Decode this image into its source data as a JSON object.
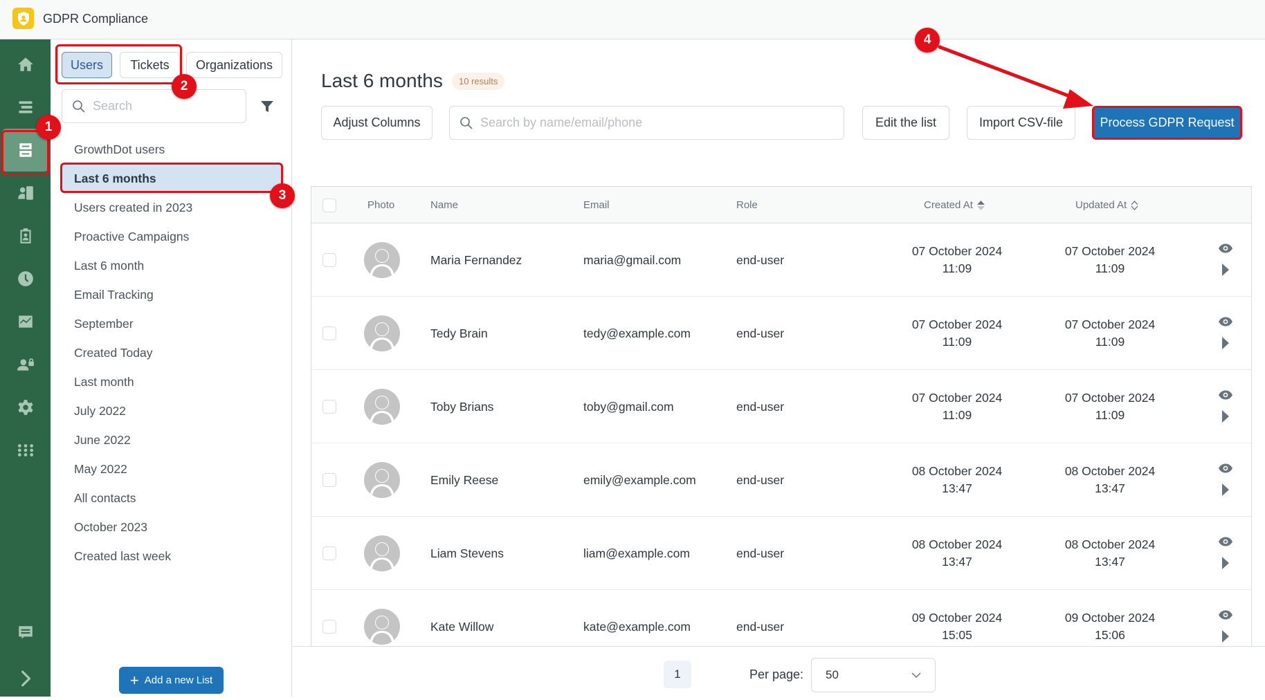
{
  "app": {
    "title": "GDPR Compliance",
    "logo_icon": "shield-user-icon",
    "logo_color": "#f5c518"
  },
  "rail": {
    "color": "#2d6647",
    "items": [
      {
        "icon": "home-icon",
        "active": false
      },
      {
        "icon": "views-icon",
        "active": false
      },
      {
        "icon": "lists-icon",
        "active": true
      },
      {
        "icon": "contacts-icon",
        "active": false
      },
      {
        "icon": "clipboard-user-icon",
        "active": false
      },
      {
        "icon": "clock-icon",
        "active": false
      },
      {
        "icon": "reports-chart-icon",
        "active": false
      },
      {
        "icon": "user-lock-icon",
        "active": false
      },
      {
        "icon": "gear-icon",
        "active": false
      },
      {
        "icon": "apps-grid-icon",
        "active": false
      }
    ],
    "bottom_items": [
      {
        "icon": "chat-icon"
      },
      {
        "icon": "chevron-right-icon"
      }
    ]
  },
  "list_panel": {
    "tabs": [
      {
        "label": "Users",
        "active": true
      },
      {
        "label": "Tickets",
        "active": false
      },
      {
        "label": "Organizations",
        "active": false
      }
    ],
    "search_placeholder": "Search",
    "items": [
      {
        "label": "GrowthDot users",
        "active": false
      },
      {
        "label": "Last 6 months",
        "active": true
      },
      {
        "label": "Users created in 2023",
        "active": false
      },
      {
        "label": "Proactive Campaigns",
        "active": false
      },
      {
        "label": "Last 6 month",
        "active": false
      },
      {
        "label": "Email Tracking",
        "active": false
      },
      {
        "label": "September",
        "active": false
      },
      {
        "label": "Created Today",
        "active": false
      },
      {
        "label": "Last month",
        "active": false
      },
      {
        "label": "July 2022",
        "active": false
      },
      {
        "label": "June 2022",
        "active": false
      },
      {
        "label": "May 2022",
        "active": false
      },
      {
        "label": "All contacts",
        "active": false
      },
      {
        "label": "October 2023",
        "active": false
      },
      {
        "label": "Created last week",
        "active": false
      }
    ],
    "add_button_label": "Add a new List"
  },
  "main": {
    "title": "Last 6 months",
    "results_badge": "10 results",
    "toolbar": {
      "adjust_columns": "Adjust Columns",
      "search_placeholder": "Search by name/email/phone",
      "edit_list": "Edit the list",
      "import_csv": "Import CSV-file",
      "process_gdpr": "Process GDPR Request"
    },
    "table": {
      "columns": [
        "Photo",
        "Name",
        "Email",
        "Role",
        "Created At",
        "Updated At"
      ],
      "rows": [
        {
          "name": "Maria Fernandez",
          "email": "maria@gmail.com",
          "role": "end-user",
          "created_date": "07 October 2024",
          "created_time": "11:09",
          "updated_date": "07 October 2024",
          "updated_time": "11:09"
        },
        {
          "name": "Tedy Brain",
          "email": "tedy@example.com",
          "role": "end-user",
          "created_date": "07 October 2024",
          "created_time": "11:09",
          "updated_date": "07 October 2024",
          "updated_time": "11:09"
        },
        {
          "name": "Toby Brians",
          "email": "toby@gmail.com",
          "role": "end-user",
          "created_date": "07 October 2024",
          "created_time": "11:09",
          "updated_date": "07 October 2024",
          "updated_time": "11:09"
        },
        {
          "name": "Emily Reese",
          "email": "emily@example.com",
          "role": "end-user",
          "created_date": "08 October 2024",
          "created_time": "13:47",
          "updated_date": "08 October 2024",
          "updated_time": "13:47"
        },
        {
          "name": "Liam Stevens",
          "email": "liam@example.com",
          "role": "end-user",
          "created_date": "08 October 2024",
          "created_time": "13:47",
          "updated_date": "08 October 2024",
          "updated_time": "13:47"
        },
        {
          "name": "Kate Willow",
          "email": "kate@example.com",
          "role": "end-user",
          "created_date": "09 October 2024",
          "created_time": "15:05",
          "updated_date": "09 October 2024",
          "updated_time": "15:06"
        }
      ]
    },
    "pagination": {
      "current_page": "1",
      "per_page_label": "Per page:",
      "per_page_value": "50"
    }
  },
  "annotations": {
    "color": "#e3101a",
    "badges": [
      "1",
      "2",
      "3",
      "4"
    ]
  }
}
